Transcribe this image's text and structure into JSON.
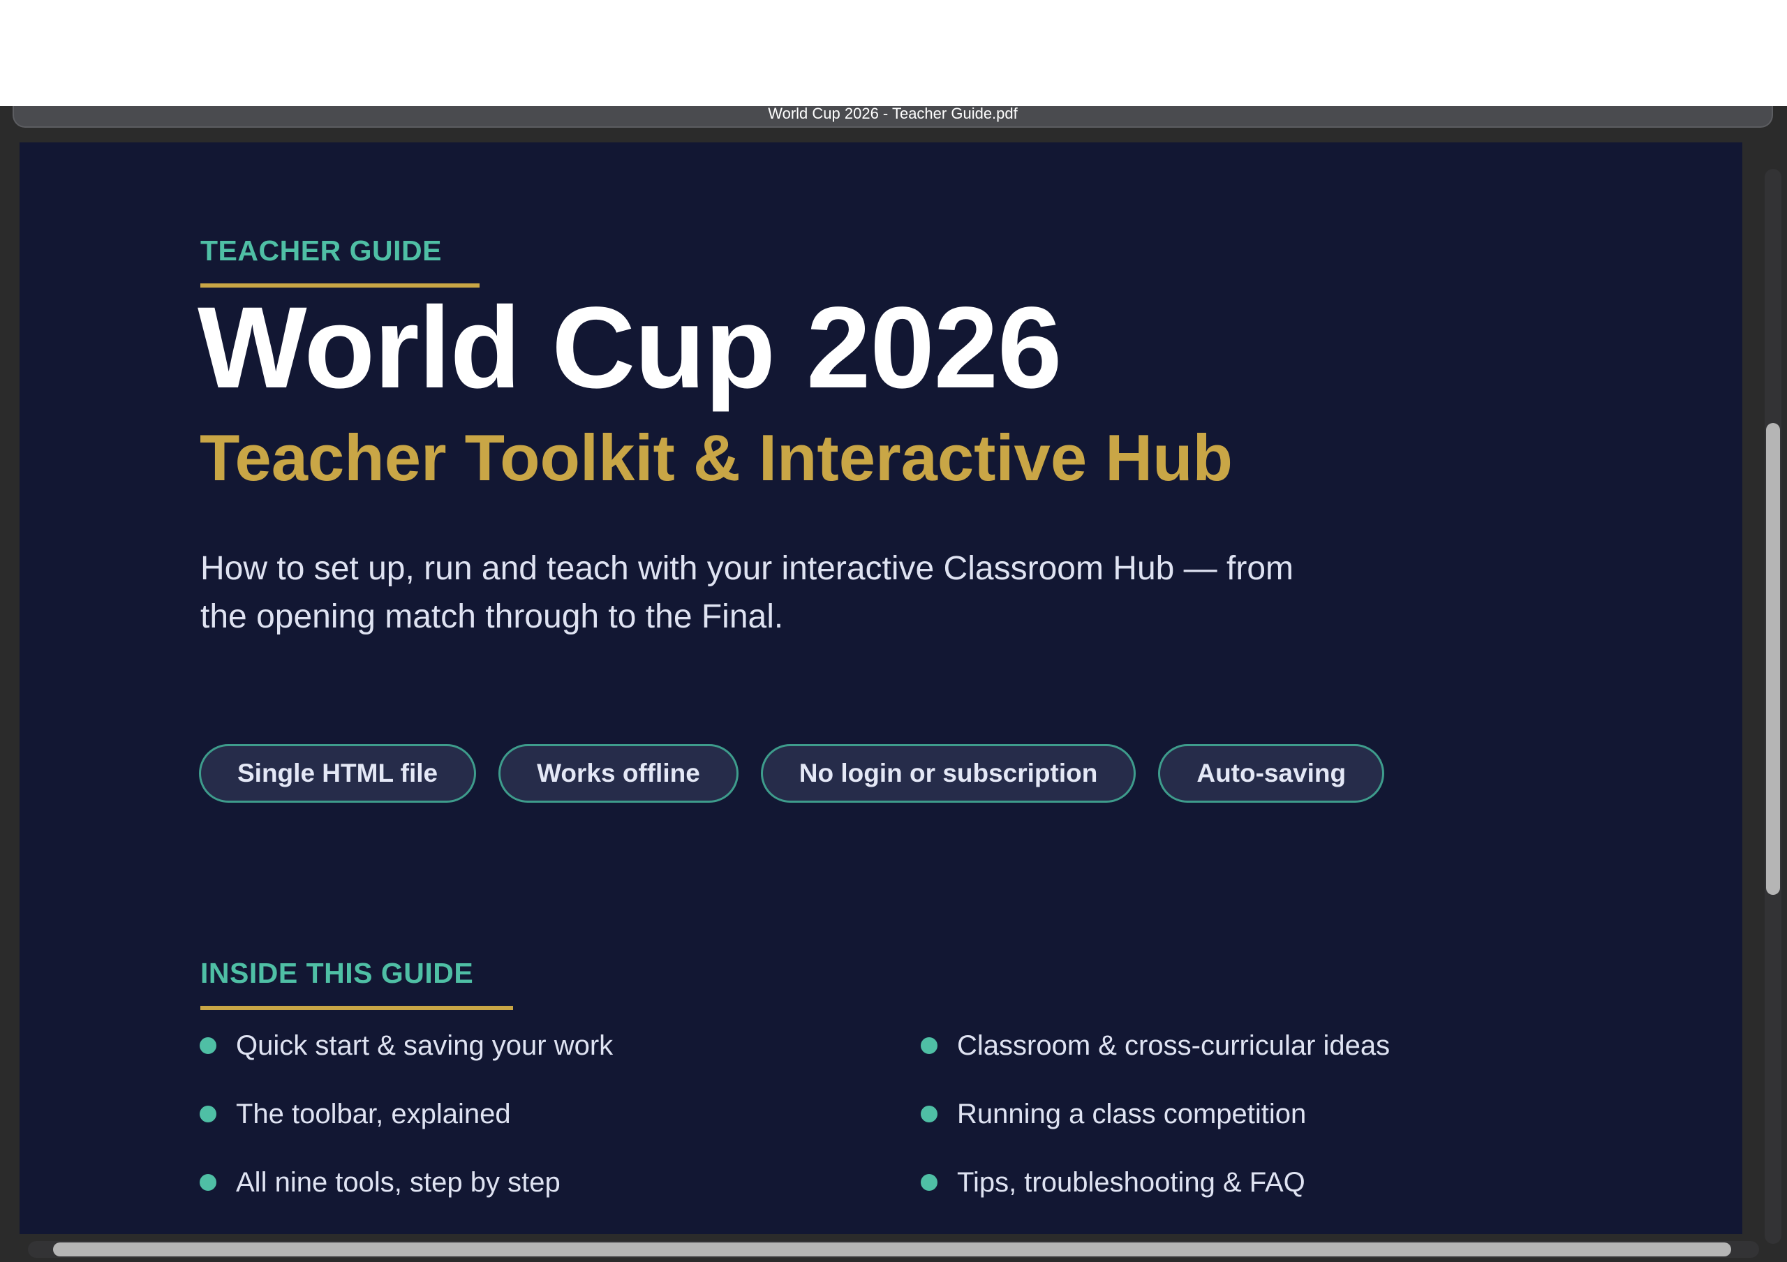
{
  "window": {
    "title": "World Cup 2026 - Teacher Guide.pdf"
  },
  "document": {
    "eyebrow": "TEACHER GUIDE",
    "title": "World Cup 2026",
    "subtitle": "Teacher Toolkit & Interactive Hub",
    "lead": "How to set up, run and teach with your interactive Classroom Hub — from the opening match through to the Final.",
    "chips": [
      "Single HTML file",
      "Works offline",
      "No login or subscription",
      "Auto-saving"
    ],
    "toc_heading": "INSIDE THIS GUIDE",
    "toc_left": [
      "Quick start & saving your work",
      "The toolbar, explained",
      "All nine tools, step by step"
    ],
    "toc_right": [
      "Classroom & cross-curricular ideas",
      "Running a class competition",
      "Tips, troubleshooting & FAQ"
    ]
  },
  "colors": {
    "page_background": "#121733",
    "accent_teal": "#4fbfa5",
    "accent_gold": "#c9a646",
    "title_white": "#ffffff"
  }
}
